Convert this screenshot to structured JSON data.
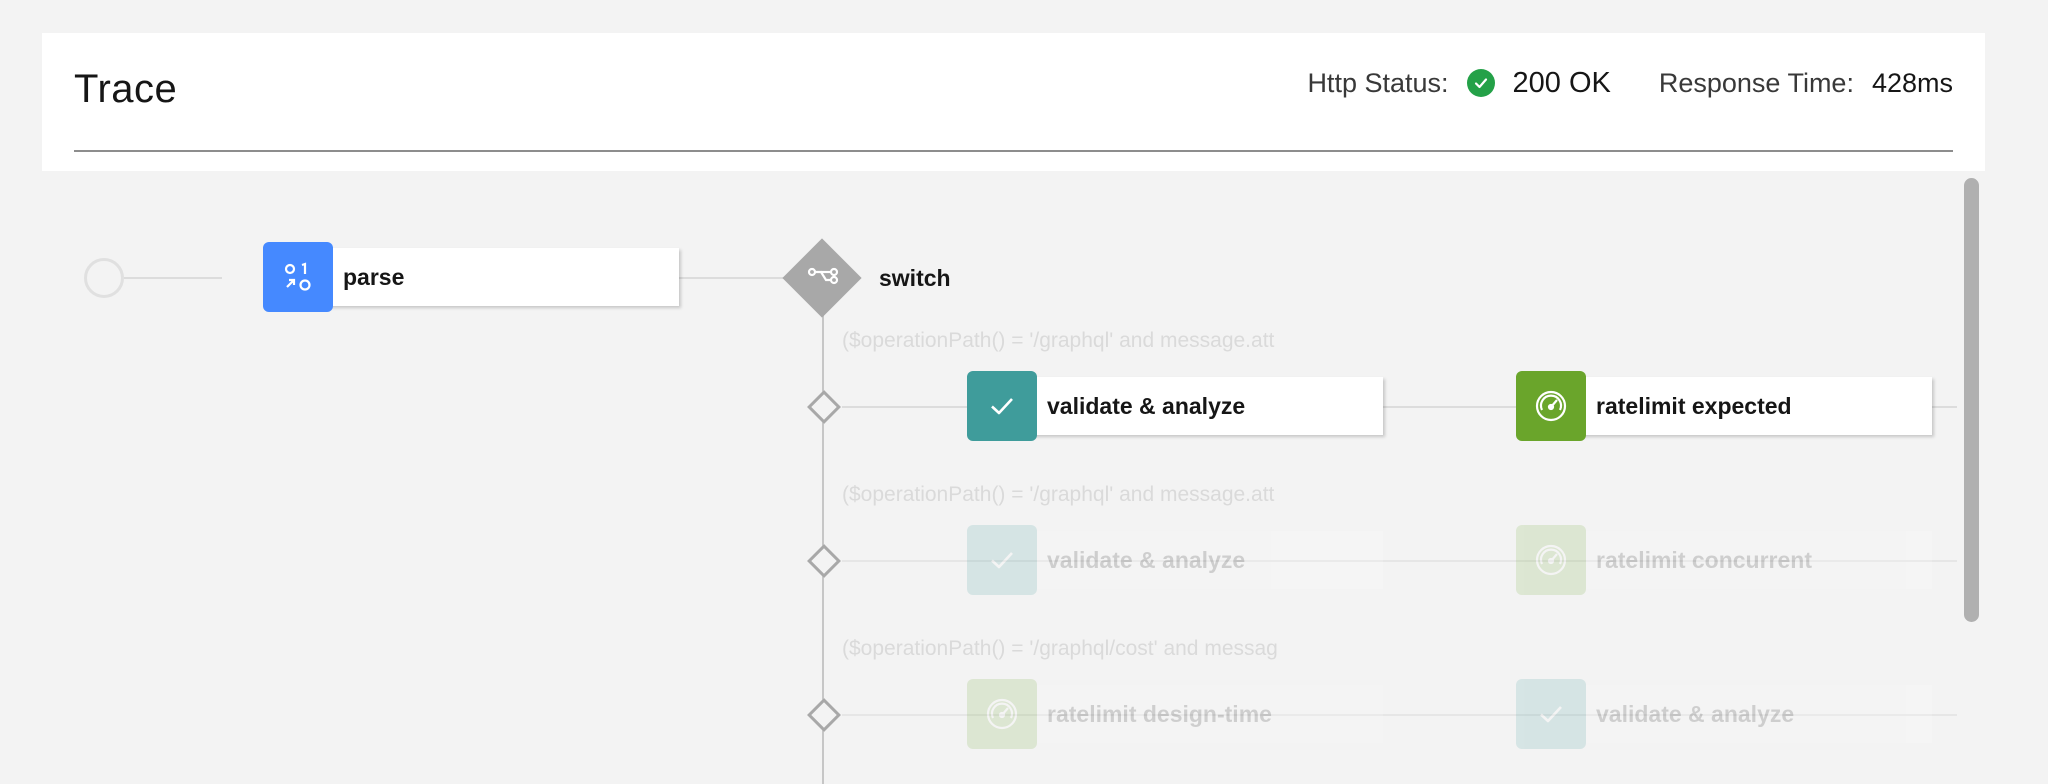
{
  "header": {
    "title": "Trace",
    "http_status_label": "Http Status:",
    "http_status_value": "200 OK",
    "response_time_label": "Response Time:",
    "response_time_value": "428ms"
  },
  "flow": {
    "parse_label": "parse",
    "switch_label": "switch",
    "branches": [
      {
        "condition": "($operationPath() = '/graphql' and message.att",
        "nodes": [
          {
            "label": "validate & analyze",
            "icon": "checkmark-icon",
            "color": "#3f9c9b"
          },
          {
            "label": "ratelimit expected",
            "icon": "gauge-icon",
            "color": "#6aa52b"
          }
        ],
        "active": true
      },
      {
        "condition": "($operationPath() = '/graphql' and message.att",
        "nodes": [
          {
            "label": "validate & analyze",
            "icon": "checkmark-icon",
            "color": "#3f9c9b"
          },
          {
            "label": "ratelimit concurrent",
            "icon": "gauge-icon",
            "color": "#6aa52b"
          }
        ],
        "active": false
      },
      {
        "condition": "($operationPath() = '/graphql/cost' and messag",
        "nodes": [
          {
            "label": "ratelimit design-time",
            "icon": "gauge-icon",
            "color": "#6aa52b"
          },
          {
            "label": "validate & analyze",
            "icon": "checkmark-icon",
            "color": "#3f9c9b"
          }
        ],
        "active": false
      }
    ]
  },
  "colors": {
    "parse": "#4589ff",
    "validate": "#3f9c9b",
    "ratelimit": "#6aa52b",
    "status_ok": "#24a148",
    "switch": "#a8a8a8"
  }
}
